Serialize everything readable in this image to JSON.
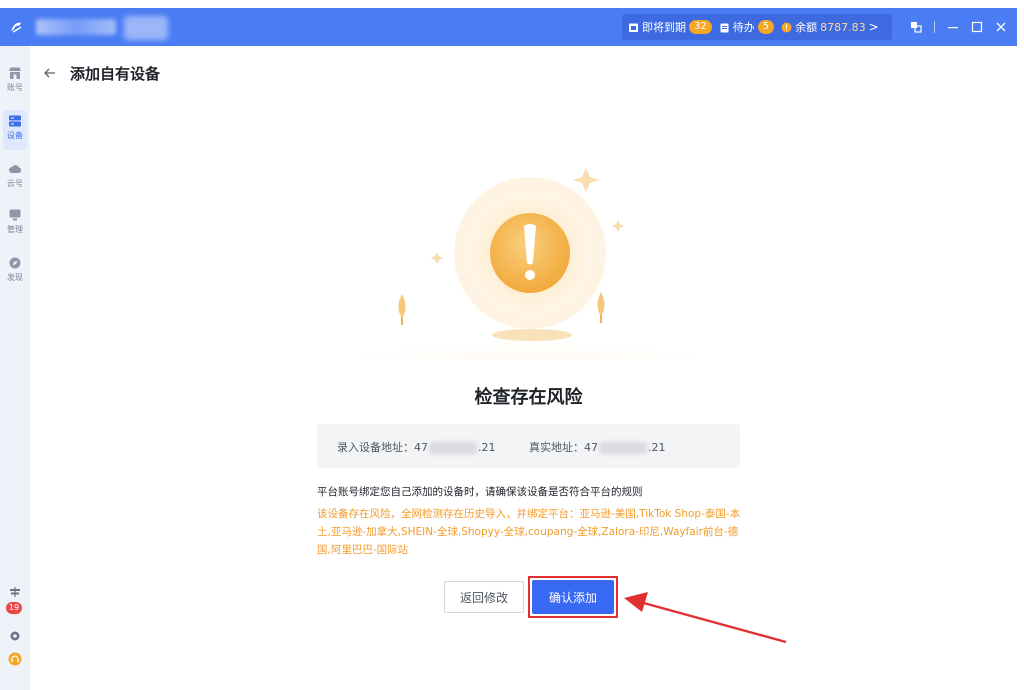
{
  "titlebar": {
    "expiring_label": "即将到期",
    "expiring_count": "32",
    "todo_label": "待办",
    "todo_count": "5",
    "balance_label": "余额",
    "balance_value": "8787.83",
    "chevron": ">"
  },
  "sidebar": {
    "items": [
      {
        "label": "账号",
        "icon": "store-icon"
      },
      {
        "label": "设备",
        "icon": "device-icon"
      },
      {
        "label": "云号",
        "icon": "cloud-icon"
      },
      {
        "label": "管理",
        "icon": "monitor-icon"
      },
      {
        "label": "发现",
        "icon": "compass-icon"
      }
    ],
    "notif_count": "19",
    "active_index": 1
  },
  "header": {
    "title": "添加自有设备"
  },
  "main": {
    "risk_title": "检查存在风险",
    "entered_addr_label": "录入设备地址：",
    "entered_addr_prefix": "47",
    "entered_addr_suffix": ".21",
    "real_addr_label": "真实地址：",
    "real_addr_prefix": "47",
    "real_addr_suffix": ".21",
    "rule_text": "平台账号绑定您自己添加的设备时，请确保该设备是否符合平台的规则",
    "warn_text": "该设备存在风险，全网检测存在历史导入，并绑定平台：亚马逊-美国,TikTok Shop-泰国-本土,亚马逊-加拿大,SHEIN-全球,Shopyy-全球,coupang-全球,Zalora-印尼,Wayfair前台-德国,阿里巴巴-国际站",
    "back_button": "返回修改",
    "confirm_button": "确认添加"
  },
  "colors": {
    "titlebar": "#4a7cf4",
    "primary": "#3869f2",
    "warning": "#f39b2a",
    "highlight": "#e03030"
  }
}
